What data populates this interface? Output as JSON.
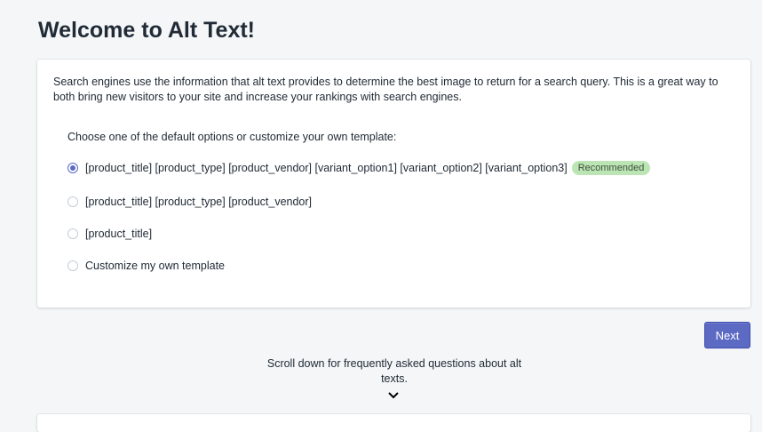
{
  "header": {
    "title": "Welcome to Alt Text!"
  },
  "card": {
    "intro": "Search engines use the information that alt text provides to determine the best image to return for a search query. This is a great way to both bring new visitors to your site and increase your rankings with search engines.",
    "prompt": "Choose one of the default options or customize your own template:",
    "options": [
      {
        "label": "[product_title] [product_type] [product_vendor] [variant_option1] [variant_option2] [variant_option3]",
        "selected": true,
        "badge": "Recommended"
      },
      {
        "label": "[product_title] [product_type] [product_vendor]",
        "selected": false
      },
      {
        "label": "[product_title]",
        "selected": false
      },
      {
        "label": "Customize my own template",
        "selected": false
      }
    ]
  },
  "actions": {
    "next_label": "Next"
  },
  "footer": {
    "scroll_hint": "Scroll down for frequently asked questions about alt texts."
  },
  "icons": {
    "scroll_down": "chevron-down-icon"
  },
  "colors": {
    "accent": "#5c6ac4",
    "badge_bg": "#bbe5b3",
    "background": "#f4f6f8"
  }
}
